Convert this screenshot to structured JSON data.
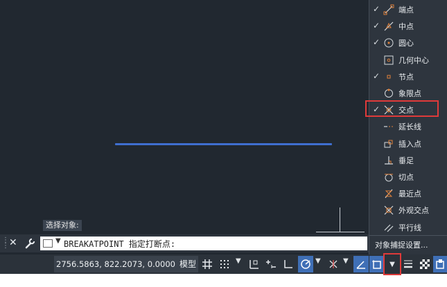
{
  "command": {
    "prompt_hint": "选择对象:",
    "command_text": "BREAKATPOINT 指定打断点:"
  },
  "status": {
    "coordinates": "2756.5863, 822.2073, 0.0000",
    "model_label": "模型"
  },
  "osnap_menu": {
    "items": [
      {
        "label": "端点",
        "checked": true,
        "icon": "endpoint-icon"
      },
      {
        "label": "中点",
        "checked": true,
        "icon": "midpoint-icon"
      },
      {
        "label": "圆心",
        "checked": true,
        "icon": "center-icon"
      },
      {
        "label": "几何中心",
        "checked": false,
        "icon": "geometric-center-icon"
      },
      {
        "label": "节点",
        "checked": true,
        "icon": "node-icon"
      },
      {
        "label": "象限点",
        "checked": false,
        "icon": "quadrant-icon"
      },
      {
        "label": "交点",
        "checked": true,
        "icon": "intersection-icon"
      },
      {
        "label": "延长线",
        "checked": false,
        "icon": "extension-icon"
      },
      {
        "label": "插入点",
        "checked": false,
        "icon": "insertion-icon"
      },
      {
        "label": "垂足",
        "checked": false,
        "icon": "perpendicular-icon"
      },
      {
        "label": "切点",
        "checked": false,
        "icon": "tangent-icon"
      },
      {
        "label": "最近点",
        "checked": false,
        "icon": "nearest-icon"
      },
      {
        "label": "外观交点",
        "checked": false,
        "icon": "apparent-intersection-icon"
      },
      {
        "label": "平行线",
        "checked": false,
        "icon": "parallel-icon"
      }
    ],
    "settings_label": "对象捕捉设置..."
  },
  "colors": {
    "canvas": "#212830",
    "line": "#3f6fd0",
    "highlight": "#e03a3a",
    "active_button": "#3f6fb6"
  }
}
